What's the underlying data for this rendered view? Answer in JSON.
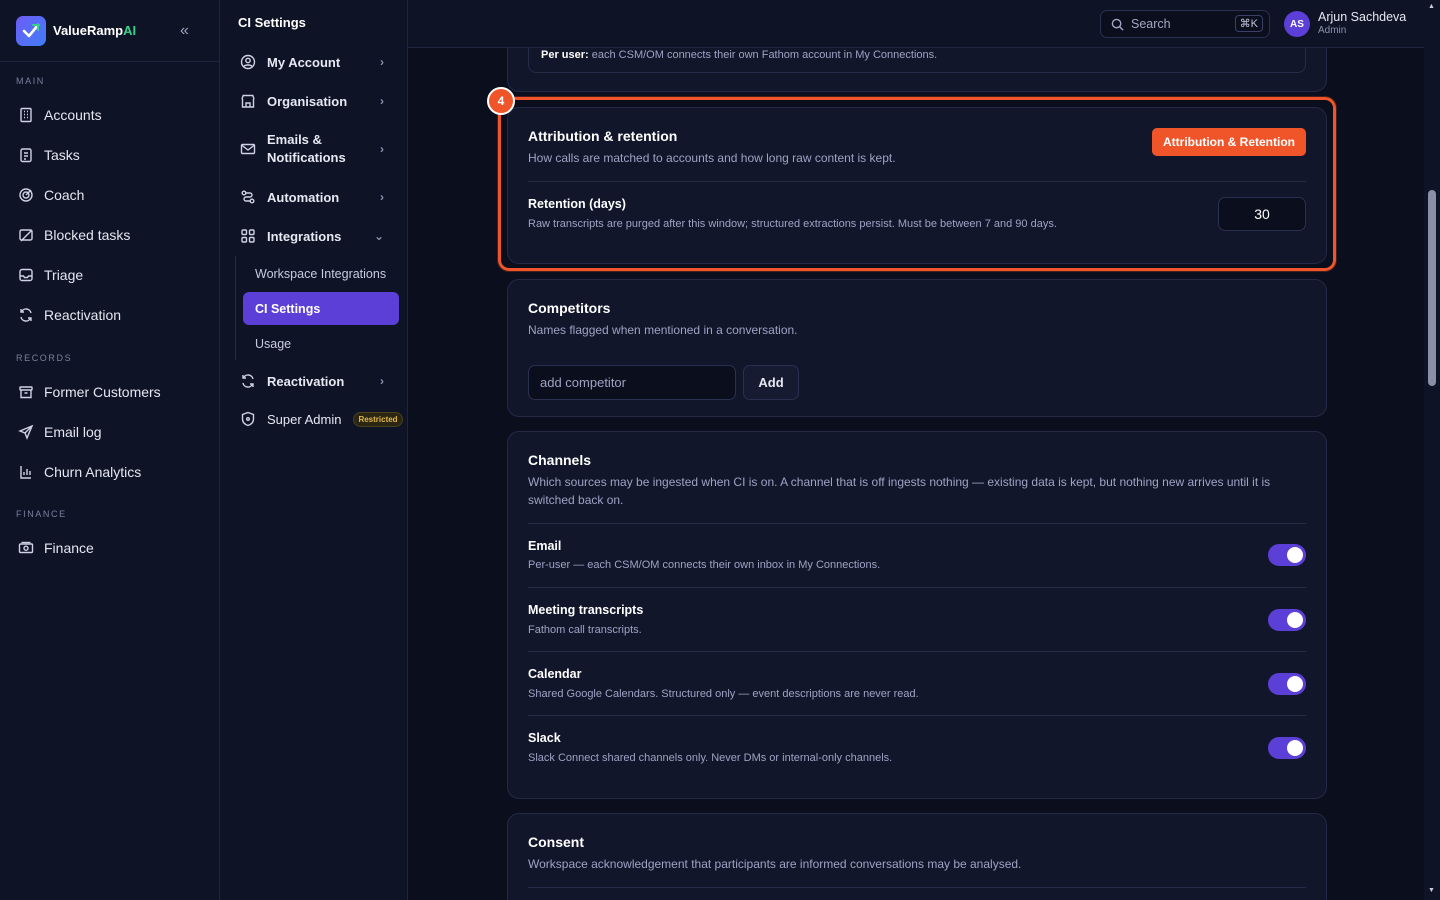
{
  "brand": {
    "name": "ValueRamp",
    "suffix": "AI"
  },
  "sidebar": {
    "sections": [
      {
        "label": "MAIN",
        "items": [
          {
            "label": "Accounts",
            "icon": "building-icon"
          },
          {
            "label": "Tasks",
            "icon": "clipboard-icon"
          },
          {
            "label": "Coach",
            "icon": "target-icon"
          },
          {
            "label": "Blocked tasks",
            "icon": "blocked-icon"
          },
          {
            "label": "Triage",
            "icon": "inbox-icon"
          },
          {
            "label": "Reactivation",
            "icon": "refresh-icon"
          }
        ]
      },
      {
        "label": "RECORDS",
        "items": [
          {
            "label": "Former Customers",
            "icon": "archive-icon"
          },
          {
            "label": "Email log",
            "icon": "send-icon"
          },
          {
            "label": "Churn Analytics",
            "icon": "chart-icon"
          }
        ]
      },
      {
        "label": "FINANCE",
        "items": [
          {
            "label": "Finance",
            "icon": "cash-icon"
          }
        ]
      }
    ]
  },
  "subnav": {
    "title": "CI Settings",
    "items": [
      {
        "label": "My Account"
      },
      {
        "label": "Organisation"
      },
      {
        "label": "Emails &",
        "label2": "Notifications"
      },
      {
        "label": "Automation"
      },
      {
        "label": "Integrations"
      },
      {
        "label": "Reactivation"
      },
      {
        "label": "Super Admin",
        "badge": "Restricted"
      }
    ],
    "sub_items": [
      "Workspace Integrations",
      "CI Settings",
      "Usage"
    ]
  },
  "topbar": {
    "search_placeholder": "Search",
    "shortcut": "⌘K",
    "user_initials": "AS",
    "user_name": "Arjun Sachdeva",
    "user_role": "Admin"
  },
  "prev_card": {
    "text_bold": "Per user:",
    "text": "each CSM/OM connects their own Fathom account in My Connections."
  },
  "attribution": {
    "step": "4",
    "tag": "Attribution & Retention",
    "title": "Attribution & retention",
    "desc": "How calls are matched to accounts and how long raw content is kept.",
    "retention_title": "Retention (days)",
    "retention_desc": "Raw transcripts are purged after this window; structured extractions persist. Must be between 7 and 90 days.",
    "retention_value": "30"
  },
  "competitors": {
    "title": "Competitors",
    "desc": "Names flagged when mentioned in a conversation.",
    "input_placeholder": "add competitor",
    "add_label": "Add"
  },
  "channels": {
    "title": "Channels",
    "desc": "Which sources may be ingested when CI is on. A channel that is off ingests nothing — existing data is kept, but nothing new arrives until it is switched back on.",
    "rows": [
      {
        "title": "Email",
        "desc": "Per-user — each CSM/OM connects their own inbox in My Connections.",
        "on": true
      },
      {
        "title": "Meeting transcripts",
        "desc": "Fathom call transcripts.",
        "on": true
      },
      {
        "title": "Calendar",
        "desc": "Shared Google Calendars. Structured only — event descriptions are never read.",
        "on": true
      },
      {
        "title": "Slack",
        "desc": "Slack Connect shared channels only. Never DMs or internal-only channels.",
        "on": true
      }
    ]
  },
  "consent": {
    "title": "Consent",
    "desc": "Workspace acknowledgement that participants are informed conversations may be analysed."
  },
  "colors": {
    "accent": "#5b3fd6",
    "highlight": "#f0552a",
    "brand_ai": "#35d48a"
  }
}
